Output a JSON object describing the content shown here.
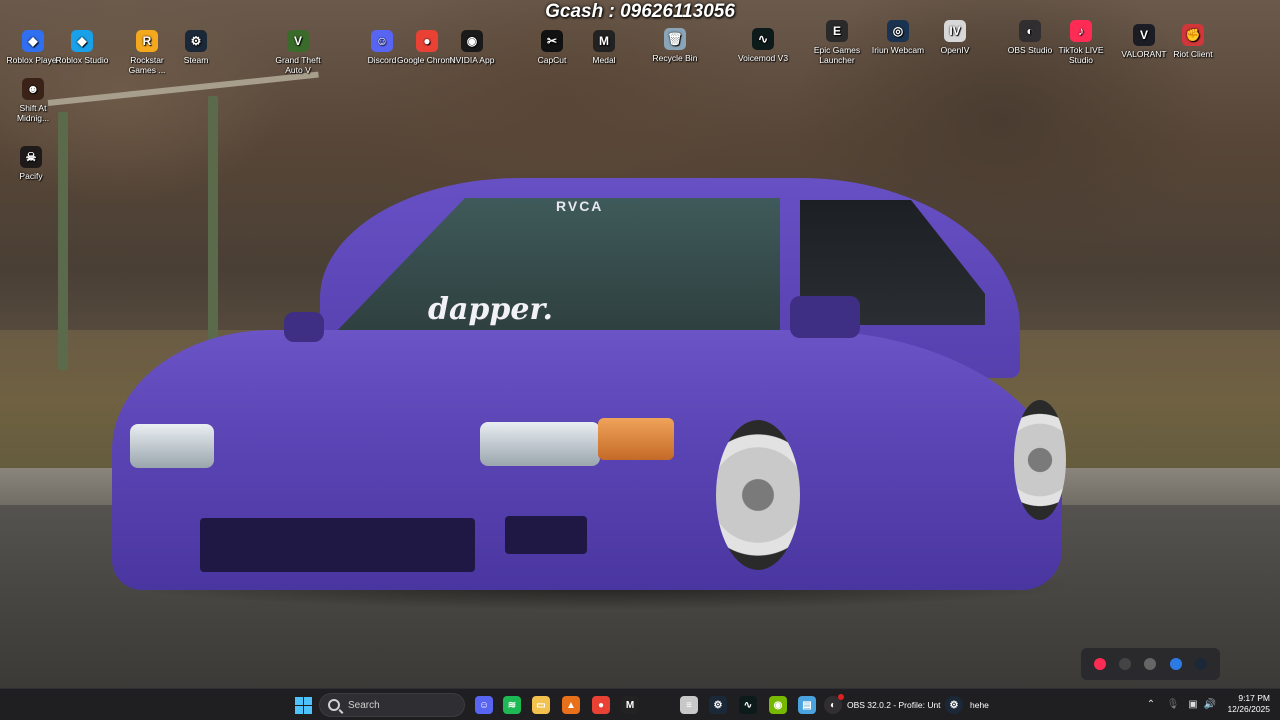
{
  "banner": {
    "text": "Gcash : 09626113056"
  },
  "desktop_icons": [
    {
      "label": "Roblox Player",
      "icon": "roblox-player-icon",
      "color": "#2f6ff0",
      "glyph": "◆"
    },
    {
      "label": "Roblox Studio",
      "icon": "roblox-studio-icon",
      "color": "#19a0e8",
      "glyph": "◆"
    },
    {
      "label": "Rockstar Games ...",
      "icon": "rockstar-games-icon",
      "color": "#f4a81d",
      "glyph": "R"
    },
    {
      "label": "Steam",
      "icon": "steam-icon",
      "color": "#1b2838",
      "glyph": "⚙"
    },
    {
      "label": "Grand Theft Auto V",
      "icon": "gta-v-icon",
      "color": "#3b6b2a",
      "glyph": "V"
    },
    {
      "label": "Discord",
      "icon": "discord-icon",
      "color": "#5865f2",
      "glyph": "☺"
    },
    {
      "label": "Google Chrome",
      "icon": "chrome-icon",
      "color": "#e94235",
      "glyph": "●"
    },
    {
      "label": "NVIDIA App",
      "icon": "nvidia-icon",
      "color": "#1a1a1a",
      "glyph": "◉"
    },
    {
      "label": "CapCut",
      "icon": "capcut-icon",
      "color": "#111111",
      "glyph": "✂"
    },
    {
      "label": "Medal",
      "icon": "medal-icon",
      "color": "#222222",
      "glyph": "M"
    },
    {
      "label": "Recycle Bin",
      "icon": "recycle-bin-icon",
      "color": "#8aa4b8",
      "glyph": "🗑"
    },
    {
      "label": "Voicemod V3",
      "icon": "voicemod-icon",
      "color": "#0d1a1a",
      "glyph": "∿"
    },
    {
      "label": "Epic Games Launcher",
      "icon": "epic-games-icon",
      "color": "#2a2a2a",
      "glyph": "E"
    },
    {
      "label": "Iriun Webcam",
      "icon": "iriun-webcam-icon",
      "color": "#1a3350",
      "glyph": "◎"
    },
    {
      "label": "OpenIV",
      "icon": "openiv-icon",
      "color": "#d8d8d8",
      "glyph": "IV"
    },
    {
      "label": "OBS Studio",
      "icon": "obs-studio-icon",
      "color": "#302e31",
      "glyph": "◐"
    },
    {
      "label": "TikTok LIVE Studio",
      "icon": "tiktok-live-icon",
      "color": "#fe2c55",
      "glyph": "♪"
    },
    {
      "label": "VALORANT",
      "icon": "valorant-icon",
      "color": "#1c1c24",
      "glyph": "V"
    },
    {
      "label": "Riot Client",
      "icon": "riot-client-icon",
      "color": "#d13639",
      "glyph": "✊"
    },
    {
      "label": "Shift At Midnig...",
      "icon": "shift-at-midnight-icon",
      "color": "#3a2218",
      "glyph": "☻"
    },
    {
      "label": "Pacify",
      "icon": "pacify-icon",
      "color": "#1e1a1a",
      "glyph": "☠"
    }
  ],
  "wallpaper": {
    "sticker_top": "RVCA",
    "sticker_main": "dapper."
  },
  "tray_popup": [
    {
      "icon": "tiktok-tray-icon",
      "color": "#fe2c55"
    },
    {
      "icon": "obs-tray-icon",
      "color": "#444444"
    },
    {
      "icon": "usb-tray-icon",
      "color": "#666666"
    },
    {
      "icon": "bluetooth-tray-icon",
      "color": "#2c7be5"
    },
    {
      "icon": "steam-tray-icon",
      "color": "#1b2838"
    }
  ],
  "taskbar": {
    "search_placeholder": "Search",
    "pinned": [
      {
        "icon": "discord-taskbar-icon",
        "color": "#5865f2",
        "glyph": "☺"
      },
      {
        "icon": "spotify-taskbar-icon",
        "color": "#1db954",
        "glyph": "≋"
      },
      {
        "icon": "file-explorer-taskbar-icon",
        "color": "#f2c14e",
        "glyph": "▭"
      },
      {
        "icon": "vlc-taskbar-icon",
        "color": "#e8701a",
        "glyph": "▲"
      },
      {
        "icon": "chrome-taskbar-icon",
        "color": "#e94235",
        "glyph": "●"
      },
      {
        "icon": "medal-taskbar-icon",
        "color": "#222222",
        "glyph": "M"
      },
      {
        "icon": "notepad-taskbar-icon",
        "color": "#c8c8c8",
        "glyph": "≡"
      },
      {
        "icon": "steam-taskbar-icon",
        "color": "#1b2838",
        "glyph": "⚙"
      },
      {
        "icon": "voicemod-taskbar-icon",
        "color": "#0d1a1a",
        "glyph": "∿"
      },
      {
        "icon": "nvidia-taskbar-icon",
        "color": "#76b900",
        "glyph": "◉"
      },
      {
        "icon": "notes-taskbar-icon",
        "color": "#4aa3df",
        "glyph": "▤"
      }
    ],
    "obs_window": "OBS 32.0.2 - Profile: Unt",
    "steam_window": "hehe",
    "time": "9:17 PM",
    "date": "12/26/2025"
  }
}
